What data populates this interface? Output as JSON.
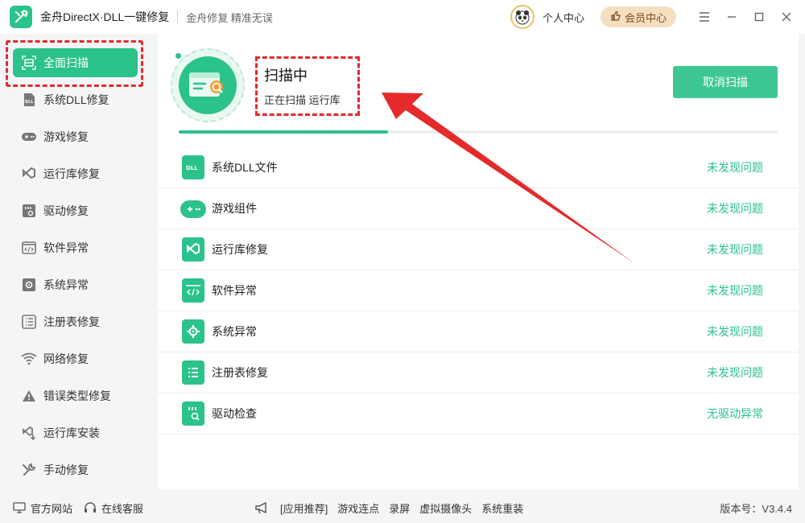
{
  "titlebar": {
    "app_title": "金舟DirectX·DLL一键修复",
    "slogan": "金舟修复 精准无误",
    "user_center": "个人中心",
    "vip_center": "会员中心"
  },
  "sidebar": {
    "items": [
      {
        "label": "全面扫描",
        "icon": "scan-icon"
      },
      {
        "label": "系统DLL修复",
        "icon": "dll-icon"
      },
      {
        "label": "游戏修复",
        "icon": "gamepad-icon"
      },
      {
        "label": "运行库修复",
        "icon": "runtime-icon"
      },
      {
        "label": "驱动修复",
        "icon": "driver-icon"
      },
      {
        "label": "软件异常",
        "icon": "code-icon"
      },
      {
        "label": "系统异常",
        "icon": "gear-icon"
      },
      {
        "label": "注册表修复",
        "icon": "list-icon"
      },
      {
        "label": "网络修复",
        "icon": "wifi-icon"
      },
      {
        "label": "错误类型修复",
        "icon": "warning-icon"
      },
      {
        "label": "运行库安装",
        "icon": "install-icon"
      },
      {
        "label": "手动修复",
        "icon": "wrench-icon"
      }
    ]
  },
  "scan": {
    "title": "扫描中",
    "subtitle": "正在扫描 运行库",
    "cancel_label": "取消扫描",
    "progress": 0.35
  },
  "results": [
    {
      "name": "系统DLL文件",
      "status": "未发现问题",
      "icon": "dll-icon"
    },
    {
      "name": "游戏组件",
      "status": "未发现问题",
      "icon": "gamepad-icon"
    },
    {
      "name": "运行库修复",
      "status": "未发现问题",
      "icon": "runtime-icon"
    },
    {
      "name": "软件异常",
      "status": "未发现问题",
      "icon": "code-icon"
    },
    {
      "name": "系统异常",
      "status": "未发现问题",
      "icon": "gear-icon"
    },
    {
      "name": "注册表修复",
      "status": "未发现问题",
      "icon": "list-icon"
    },
    {
      "name": "驱动检查",
      "status": "无驱动异常",
      "icon": "driver-icon"
    }
  ],
  "bottombar": {
    "site": "官方网站",
    "service": "在线客服",
    "recommend": "[应用推荐]",
    "links": [
      "游戏连点",
      "录屏",
      "虚拟摄像头",
      "系统重装"
    ],
    "version": "版本号：V3.4.4"
  },
  "colors": {
    "accent": "#2bc28b",
    "annotation": "#e42a2a",
    "vip_bg": "#f5dfc0"
  }
}
